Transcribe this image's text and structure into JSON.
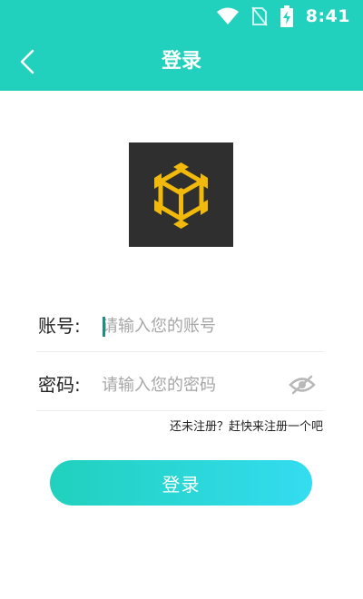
{
  "status_bar": {
    "time": "8:41",
    "icons": [
      "wifi-icon",
      "no-sim-icon",
      "battery-charging-icon"
    ]
  },
  "app_bar": {
    "title": "登录",
    "back_icon": "back-arrow-icon"
  },
  "logo": {
    "icon": "cube-logo-icon"
  },
  "form": {
    "account": {
      "label": "账号:",
      "placeholder": "请输入您的账号",
      "value": ""
    },
    "password": {
      "label": "密码:",
      "placeholder": "请输入您的密码",
      "value": "",
      "visibility_icon": "eye-off-icon"
    }
  },
  "register_link": "还未注册？赶快来注册一个吧",
  "login_button": "登录",
  "colors": {
    "primary": "#21d1bd",
    "gradient_end": "#34dcf0",
    "logo_background": "#2f2f2f",
    "logo_gold": "#f0b90b"
  }
}
